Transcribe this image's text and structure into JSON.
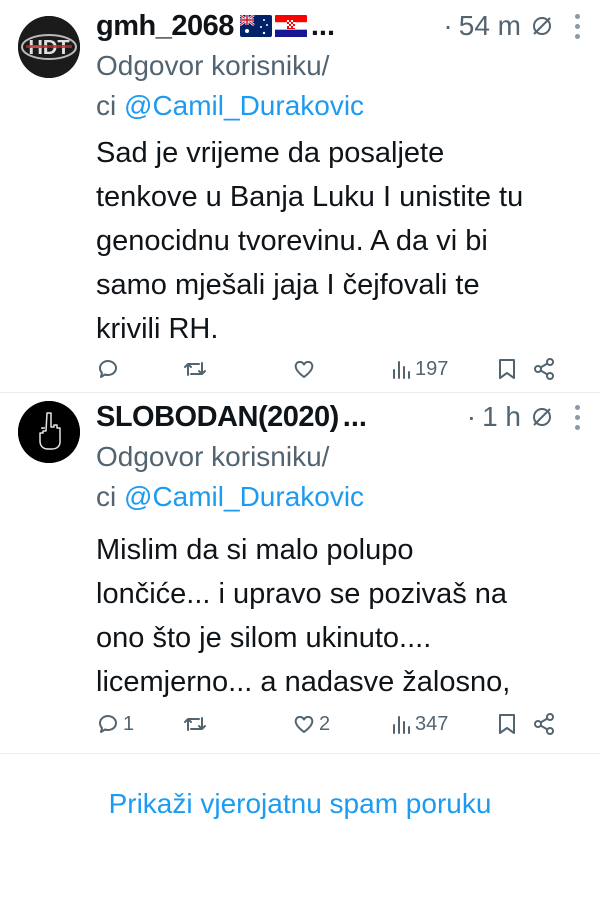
{
  "tweets": [
    {
      "handle": "gmh_2068",
      "flags": [
        "australia-flag",
        "croatia-flag"
      ],
      "truncation": "...",
      "separator": "·",
      "time": "54 m",
      "reply_prefix": "Odgovor korisniku/",
      "reply_prefix2": "ci",
      "mention": "@Camil_Durakovic",
      "lines": [
        "Sad je vrijeme da posaljete",
        "tenkove u Banja Luku I unistite tu",
        "genocidnu tvorevinu. A da vi bi",
        "samo mješali jaja I čejfovali te",
        "krivili RH."
      ],
      "replies": "",
      "retweets": "",
      "likes": "",
      "views": "197"
    },
    {
      "handle": "SLOBODAN(2020)",
      "flags": [],
      "truncation": "...",
      "separator": "·",
      "time": "1 h",
      "reply_prefix": "Odgovor korisniku/",
      "reply_prefix2": "ci",
      "mention": "@Camil_Durakovic",
      "lines": [
        "Mislim da si malo polupo",
        "lončiće... i upravo se pozivaš na",
        "ono što je silom ukinuto....",
        "licemjerno... a nadasve žalosno,"
      ],
      "replies": "1",
      "retweets": "",
      "likes": "2",
      "views": "347"
    }
  ],
  "spam_link": "Prikaži vjerojatnu spam poruku",
  "colors": {
    "accent": "#1d9bf0",
    "secondary_text": "#536471",
    "primary_text": "#0f1419"
  }
}
